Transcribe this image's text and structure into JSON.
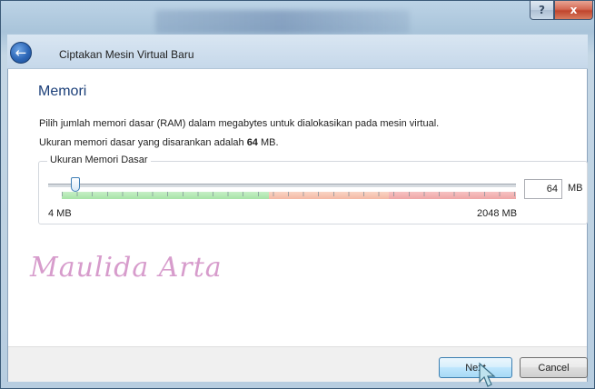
{
  "window": {
    "help_label": "?",
    "close_label": "x"
  },
  "wizard": {
    "title": "Ciptakan Mesin Virtual Baru",
    "heading": "Memori",
    "description_1": "Pilih jumlah memori dasar (RAM) dalam megabytes untuk dialokasikan pada mesin virtual.",
    "description_2_prefix": "Ukuran memori dasar yang disarankan adalah ",
    "description_2_value": "64",
    "description_2_suffix": " MB."
  },
  "memory": {
    "group_label": "Ukuran Memori Dasar",
    "value": "64",
    "unit": "MB",
    "min_label": "4 MB",
    "max_label": "2048 MB",
    "slider_level": 0.03
  },
  "watermark": "Maulida Arta",
  "buttons": {
    "next_label": "Next",
    "cancel_label": "Cancel"
  },
  "colors": {
    "heading": "#1b3f79",
    "safe_zone": "#a6e3a6",
    "warn_zone": "#f4b8a4",
    "danger_zone": "#efa6a6"
  },
  "icons": {
    "back": "back-arrow-icon",
    "cursor": "mouse-pointer-icon"
  }
}
